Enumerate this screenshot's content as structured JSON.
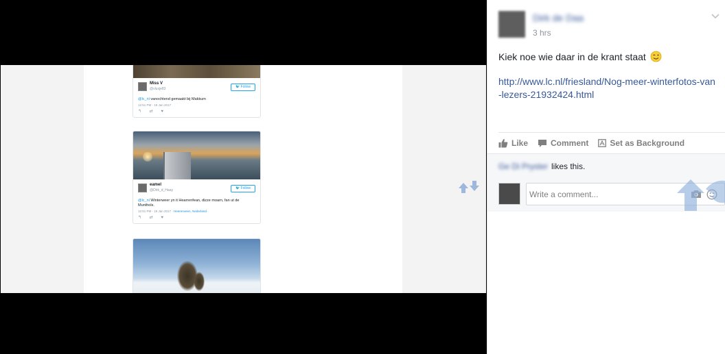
{
  "tweets": [
    {
      "name": "Miss V",
      "handle": "@vluxje83",
      "follow": "Follow",
      "mention": "@lc_nl",
      "text": " vanochtend gemaakt bij Makkum",
      "time": "12:51 PM - 19 Jan 2017",
      "location": ""
    },
    {
      "name": "eamel",
      "handle": "@Dirk_d_Haay",
      "follow": "Follow",
      "mention": "@lc_nl",
      "text": " Winterweer yn it Hearrenfean, dizze moarn, fan ut de Munthols.",
      "time": "12:51 PM - 19 Jan 2017",
      "location": "Heerenveen, Nederland"
    }
  ],
  "post": {
    "author": "Dirk de Daa",
    "timestamp": "3 hrs",
    "text": "Kiek noe wie daar in de krant staat",
    "link": "http://www.lc.nl/friesland/Nog-meer-winterfotos-van-lezers-21932424.html"
  },
  "actions": {
    "like": "Like",
    "comment": "Comment",
    "background": "Set as Background"
  },
  "likes": {
    "liker": "Ge Di Pryster",
    "suffix": "likes this."
  },
  "comment": {
    "placeholder": "Write a comment..."
  },
  "colors": {
    "link": "#365899",
    "muted": "#90949c",
    "twitter": "#1da1f2"
  },
  "icons": [
    "viewer-arrows-icon",
    "chevron-down-icon",
    "wink-emoji-icon",
    "thumbs-up-icon",
    "comment-bubble-icon",
    "set-background-icon",
    "camera-icon",
    "smiley-icon",
    "overlay-arrows-icon"
  ]
}
